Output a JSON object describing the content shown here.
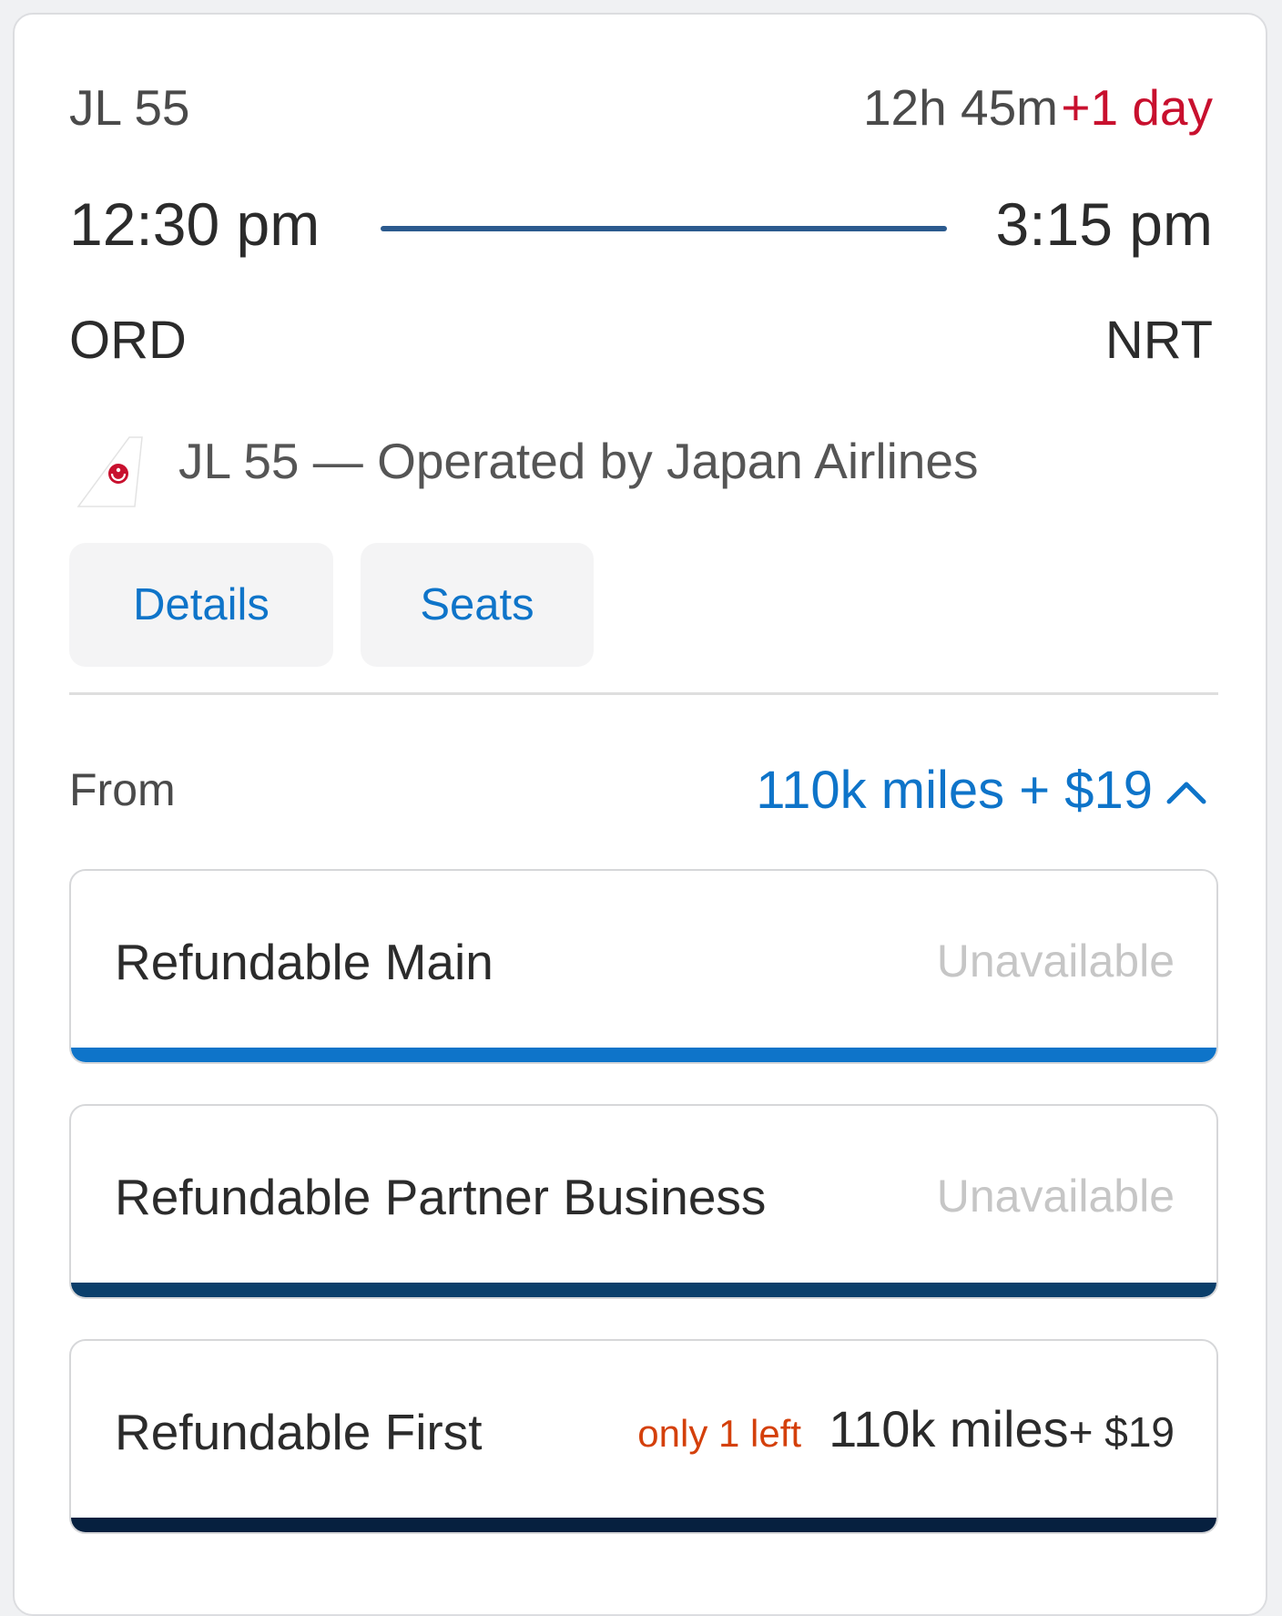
{
  "flight": {
    "number": "JL 55",
    "duration": "12h 45m",
    "day_offset": "+1 day",
    "departure_time": "12:30 pm",
    "arrival_time": "3:15 pm",
    "origin": "ORD",
    "destination": "NRT",
    "operated_by": "JL 55 — Operated by Japan Airlines",
    "airline_logo_icon": "jal-tail-logo-icon"
  },
  "actions": {
    "details_label": "Details",
    "seats_label": "Seats"
  },
  "pricing": {
    "from_label": "From",
    "from_price": "110k miles + $19",
    "toggle_icon": "chevron-up-icon"
  },
  "fares": [
    {
      "name": "Refundable Main",
      "status": "Unavailable",
      "bar_color": "#0e74c9"
    },
    {
      "name": "Refundable Partner Business",
      "status": "Unavailable",
      "bar_color": "#0b3f6b"
    },
    {
      "name": "Refundable First",
      "badge": "only 1 left",
      "price_miles": "110k miles",
      "price_cash": "+ $19",
      "bar_color": "#06203f"
    }
  ],
  "colors": {
    "accent_blue": "#0e74c9",
    "alert_red": "#c8102e",
    "badge_orange": "#d4400b",
    "route_line": "#2b5a8e"
  }
}
